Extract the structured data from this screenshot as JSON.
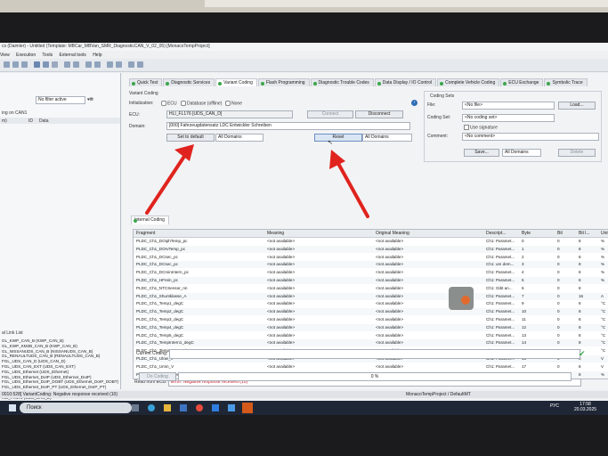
{
  "window": {
    "title": "cs (Daimler) - Untitled (Template: MBCar_MBVan_SMR_DiagnosticCAN_V_02_05) [MonacoTempProject]"
  },
  "menu": [
    "View",
    "Execution",
    "Tools",
    "External tools",
    "Help"
  ],
  "left_panel": {
    "filter": "No filter active",
    "header": "ing on CAN1",
    "cols": [
      "m)",
      "ID",
      "Data"
    ],
    "list_title": "al Link List",
    "items": [
      "GL_KWP_CAN_B (KWP_CAN_B)",
      "GL_KWP_KM2B_CAN_B (KWP_CAN_B)",
      "GL_NISSANUDS_CAN_B (NISSANUDS_CAN_B)",
      "GL_RENAULTUDS_CAN_B (RENAULTUDS_CAN_B)",
      "FGL_UDS_CAN_D (UDS_CAN_D)",
      "FGL_UDS_CAN_EXT (UDS_CAN_EXT)",
      "FGL_UDS_Ethernet (UDS_Ethernet)",
      "FGL_UDS_Ethernet_DoIP (UDS_Ethernet_DoIP)",
      "FGL_UDS_Ethernet_DoIP_DOBT (UDS_Ethernet_DoIP_DOBT)",
      "FGL_UDS_Ethernet_DoIP_PT (UDS_Ethernet_DoIP_PT)",
      "HLI_FL176 (UDS_CAN_D)",
      "HLI_FR176 (UDS_CAN_D)"
    ]
  },
  "tabs": [
    "Quick Test",
    "Diagnostic Services",
    "Variant Coding",
    "Flash Programming",
    "Diagnostic Trouble Codes",
    "Data Display / IO Control",
    "Complete Vehicle Coding",
    "ECU Exchange",
    "Symbolic Trace"
  ],
  "variant": {
    "group": "Variant Coding",
    "init_label": "Initialization:",
    "init_options": [
      "ECU",
      "Database (offline)",
      "None"
    ],
    "ecu_label": "ECU:",
    "ecu_value": "HLI_FL176 [UDS_CAN_D]",
    "connect": "Connect",
    "disconnect": "Disconnect",
    "domain_label": "Domain:",
    "domain_value": "[000] Fahrzeugdatensatz LDC Entwickler Schreiben",
    "set_default": "Set to default",
    "all_domains_1": "All Domains",
    "reset": "Reset",
    "all_domains_2": "All Domains"
  },
  "coding_sets": {
    "title": "Coding Sets",
    "file_label": "File:",
    "file_value": "<No file>",
    "load": "Load...",
    "set_label": "Coding Set:",
    "set_value": "<No coding set>",
    "use_signature": "Use signature",
    "comment_label": "Comment:",
    "comment_value": "<No comment>",
    "save": "Save...",
    "all_domains": "All Domains",
    "delete": "Delete"
  },
  "inner_tab": "Internal Coding",
  "table": {
    "headers": [
      "Fragment",
      "Meaning",
      "Original Meaning",
      "Descript...",
      "Byte",
      "Bit",
      "Bit l...",
      "Unit"
    ],
    "rows": [
      [
        "PLDC_Ch1_DOiphTemp_pc",
        "<not available>",
        "<not available>",
        "Ch1: Paramet...",
        "0",
        "0",
        "8",
        "%"
      ],
      [
        "PLDC_Ch1_DOrvTemp_pc",
        "<not available>",
        "<not available>",
        "Ch1: Paramet...",
        "1",
        "0",
        "8",
        "%"
      ],
      [
        "PLDC_Ch1_DCsec_pc",
        "<not available>",
        "<not available>",
        "Ch1: Paramet...",
        "2",
        "0",
        "8",
        "%"
      ],
      [
        "PLDC_Ch1_DCsec_pc",
        "<not available>",
        "<not available>",
        "Ch1: um dem...",
        "3",
        "0",
        "8",
        "%"
      ],
      [
        "PLDC_Ch1_DCminIntern_pc",
        "<not available>",
        "<not available>",
        "Ch1: Paramet...",
        "4",
        "0",
        "8",
        "%"
      ],
      [
        "PLDC_Ch1_HFrein_pc",
        "<not available>",
        "<not available>",
        "Ch1: Paramet...",
        "5",
        "0",
        "8",
        "%"
      ],
      [
        "PLDC_Ch1_NTCSensor_nn",
        "<not available>",
        "<not available>",
        "Ch1: Gibt an...",
        "6",
        "0",
        "8",
        ""
      ],
      [
        "PLDC_Ch1_Shuntklasse_A",
        "<not available>",
        "<not available>",
        "Ch1: Paramet...",
        "7",
        "0",
        "16",
        "A"
      ],
      [
        "PLDC_Ch1_Temp1_degC",
        "<not available>",
        "<not available>",
        "Ch1: Paramet...",
        "9",
        "0",
        "8",
        "°C"
      ],
      [
        "PLDC_Ch1_Temp2_degC",
        "<not available>",
        "<not available>",
        "Ch1: Paramet...",
        "10",
        "0",
        "8",
        "°C"
      ],
      [
        "PLDC_Ch1_Temp3_degC",
        "<not available>",
        "<not available>",
        "Ch1: Paramet...",
        "11",
        "0",
        "8",
        "°C"
      ],
      [
        "PLDC_Ch1_Temp4_degC",
        "<not available>",
        "<not available>",
        "Ch1: Paramet...",
        "12",
        "0",
        "8",
        "°C"
      ],
      [
        "PLDC_Ch1_Temp5_degC",
        "<not available>",
        "<not available>",
        "Ch1: Paramet...",
        "13",
        "0",
        "8",
        "°C"
      ],
      [
        "PLDC_Ch1_TempIntern1_degC",
        "<not available>",
        "<not available>",
        "Ch1: Paramet...",
        "14",
        "0",
        "8",
        "°C"
      ],
      [
        "PLDC_Ch1_TempIntern2_degC",
        "<not available>",
        "<not available>",
        "Ch1: Paramet...",
        "15",
        "0",
        "8",
        "°C"
      ],
      [
        "PLDC_Ch1_Ulow_V",
        "<not available>",
        "<not available>",
        "Ch1: Paramet...",
        "16",
        "0",
        "8",
        "V"
      ],
      [
        "PLDC_Ch1_Umin_V",
        "<not available>",
        "<not available>",
        "Ch1: Paramet...",
        "17",
        "0",
        "8",
        "V"
      ],
      [
        "PLDC_Ch2_DChighTemp_pc",
        "<not available>",
        "<not available>",
        "Ch2: Paramet...",
        "18",
        "0",
        "8",
        "%"
      ]
    ]
  },
  "read_from_ecu": {
    "label": "Read from ECU:",
    "value": "Error: Negative response received (10)"
  },
  "current_coding": {
    "label": "Current Coding:"
  },
  "do_coding": "Do Coding",
  "progress": {
    "text": "0 %",
    "value": 0
  },
  "status_left": "0010:528] VariantCoding: Negative response received (10)",
  "status_right": "MonacoTempProject / DefaultMT",
  "taskbar": {
    "search": "Поиск",
    "lang": "РУС",
    "time": "17:58",
    "date": "20.03.2025"
  },
  "colors": {
    "error_text": "#c8202a",
    "arrow": "#e0231e",
    "accent": "#2f6db5"
  }
}
